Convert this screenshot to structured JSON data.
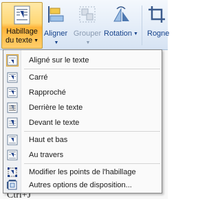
{
  "ribbon": {
    "wrap": {
      "line1": "Habillage",
      "line2": "du texte",
      "icon": "text-wrap-icon"
    },
    "align": {
      "label": "Aligner",
      "icon": "align-icon"
    },
    "group": {
      "label": "Grouper",
      "icon": "group-icon"
    },
    "rotate": {
      "label": "Rotation",
      "icon": "rotate-icon"
    },
    "crop": {
      "label": "Rogne",
      "icon": "crop-icon"
    }
  },
  "menu": {
    "items": [
      {
        "label": "Aligné sur le texte",
        "icon": "inline-with-text-icon",
        "selected": true
      },
      {
        "label": "Carré",
        "icon": "square-wrap-icon"
      },
      {
        "label": "Rapproché",
        "icon": "tight-wrap-icon"
      },
      {
        "label": "Derrière le texte",
        "icon": "behind-text-icon"
      },
      {
        "label": "Devant le texte",
        "icon": "in-front-of-text-icon"
      },
      {
        "label": "Haut et bas",
        "icon": "top-and-bottom-icon"
      },
      {
        "label": "Au travers",
        "icon": "through-wrap-icon"
      },
      {
        "label": "Modifier les points de l'habillage",
        "icon": "edit-wrap-points-icon"
      },
      {
        "label": "Autres options de disposition...",
        "icon": "more-layout-options-icon"
      }
    ]
  },
  "document": {
    "visible_text": "Ctrl+J"
  },
  "colors": {
    "ribbon_text": "#15428b",
    "active_button": "#ffd774",
    "menu_border": "#868686"
  }
}
